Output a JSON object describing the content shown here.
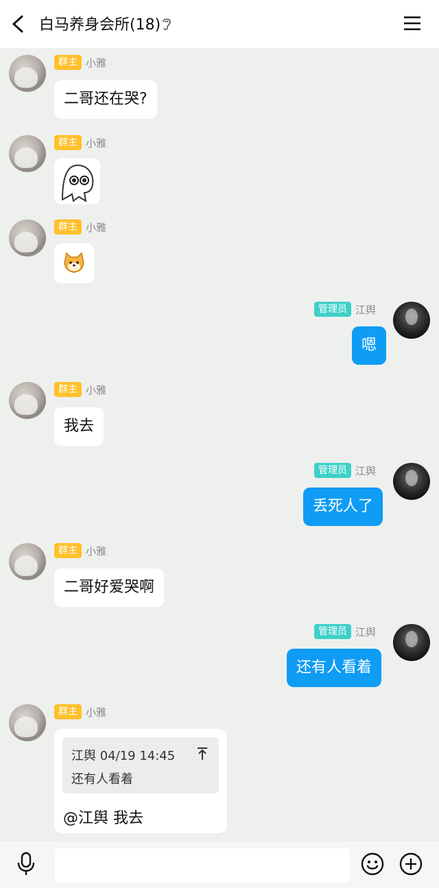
{
  "header": {
    "title": "白马养身会所(18)"
  },
  "members": {
    "owner_badge": "群主",
    "owner_name": "小雅",
    "admin_badge": "管理员",
    "admin_name": "江舆"
  },
  "messages": [
    {
      "text": "二哥还在哭?"
    },
    {
      "text": "嗯"
    },
    {
      "text": "我去"
    },
    {
      "text": "丢死人了"
    },
    {
      "text": "二哥好爱哭啊"
    },
    {
      "text": "还有人看着"
    }
  ],
  "reply": {
    "quote_header": "江舆 04/19 14:45",
    "quote_body": "还有人看着",
    "text": "@江舆 我去"
  },
  "colors": {
    "outgoing_bubble": "#0f9cf5",
    "owner_badge": "#ffc02a",
    "admin_badge": "#3fd0c9",
    "background": "#eef0ee"
  },
  "icons": [
    "back-arrow-icon",
    "ear-icon",
    "menu-icon",
    "voice-icon",
    "emoji-icon",
    "plus-icon",
    "pin-top-icon"
  ]
}
